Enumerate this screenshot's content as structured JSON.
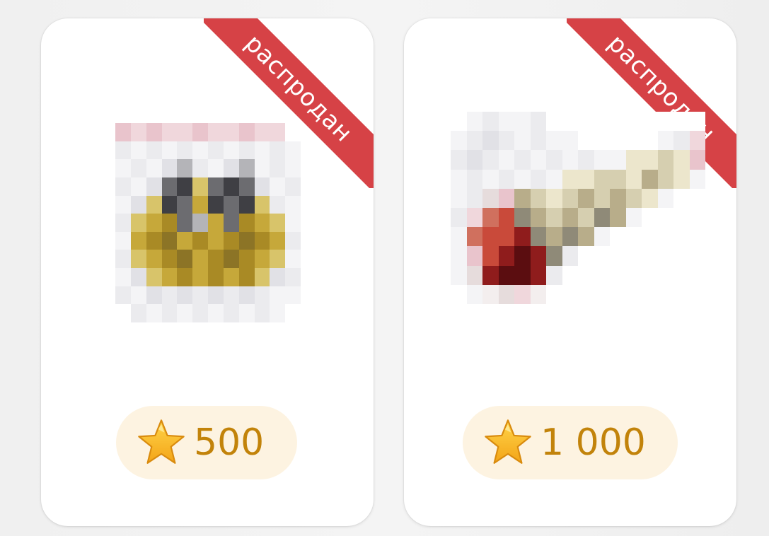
{
  "products": [
    {
      "badge": "распродан",
      "price": "500",
      "currency_icon": "star-icon",
      "image": "blurred product photo (pixelated)"
    },
    {
      "badge": "распродан",
      "price": "1 000",
      "currency_icon": "star-icon",
      "image": "blurred product photo (pixelated)"
    }
  ],
  "colors": {
    "badge_bg": "#d64246",
    "price_text": "#c2830a",
    "price_pill_bg": "#fdf3e1",
    "star": "#f6b623"
  }
}
